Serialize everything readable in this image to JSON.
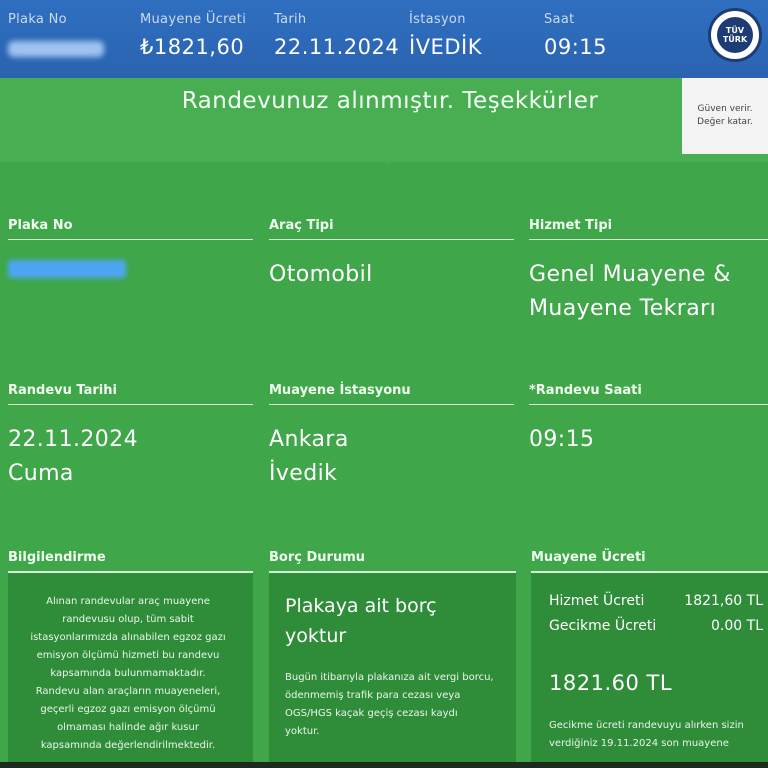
{
  "topbar": {
    "plate_label": "Plaka No",
    "fee_label": "Muayene Ücreti",
    "fee_value": "₺1821,60",
    "date_label": "Tarih",
    "date_value": "22.11.2024",
    "station_label": "İstasyon",
    "station_value": "İVEDİK",
    "time_label": "Saat",
    "time_value": "09:15",
    "logo_line1": "TÜV",
    "logo_line2": "TÜRK"
  },
  "banner": {
    "title": "Randevunuz alınmıştır. Teşekkürler",
    "slogan_line1": "Güven verir.",
    "slogan_line2": "Değer katar."
  },
  "fields": {
    "plate_label": "Plaka No",
    "vehicle_type_label": "Araç Tipi",
    "vehicle_type_value": "Otomobil",
    "service_type_label": "Hizmet Tipi",
    "service_type_line1": "Genel Muayene &",
    "service_type_line2": "Muayene Tekrarı",
    "appointment_date_label": "Randevu Tarihi",
    "appointment_date_line1": "22.11.2024",
    "appointment_date_line2": "Cuma",
    "station_label": "Muayene İstasyonu",
    "station_line1": "Ankara",
    "station_line2": "İvedik",
    "appointment_time_label": "*Randevu Saati",
    "appointment_time_value": "09:15"
  },
  "cards": {
    "info_label": "Bilgilendirme",
    "info_text": "Alınan randevular araç muayene randevusu olup, tüm sabit istasyonlarımızda alınabilen egzoz gazı emisyon ölçümü hizmeti bu randevu kapsamında bulunmamaktadır. Randevu alan araçların muayeneleri, geçerli egzoz gazı emisyon ölçümü olmaması halinde ağır kusur kapsamında değerlendirilmektedir.",
    "debt_label": "Borç Durumu",
    "debt_title_line1": "Plakaya ait borç",
    "debt_title_line2": "yoktur",
    "debt_text": "Bugün itibarıyla plakanıza ait vergi borcu, ödenmemiş trafik para cezası veya OGS/HGS kaçak geçiş cezası kaydı yoktur.",
    "fee_label": "Muayene Ücreti",
    "service_fee_label": "Hizmet Ücreti",
    "service_fee_value": "1821,60 TL",
    "late_fee_label": "Gecikme Ücreti",
    "late_fee_value": "0.00 TL",
    "total": "1821.60 TL",
    "fee_note": "Gecikme ücreti randevuyu alırken sizin verdiğiniz 19.11.2024 son muayene"
  }
}
